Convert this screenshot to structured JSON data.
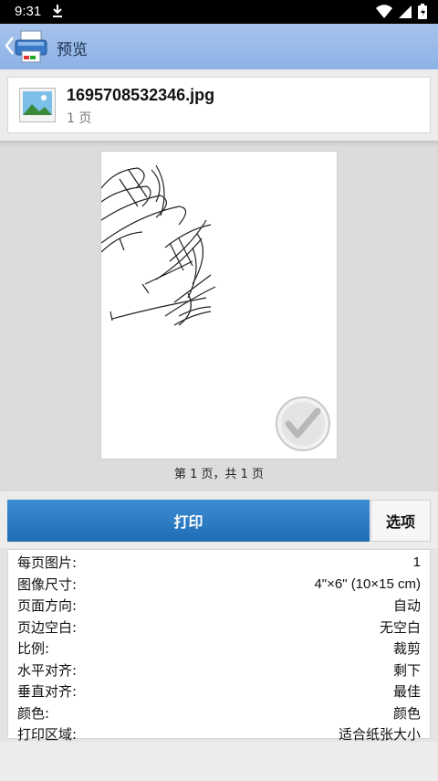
{
  "status_bar": {
    "time": "9:31"
  },
  "app_bar": {
    "title": "预览"
  },
  "file": {
    "name": "1695708532346.jpg",
    "pages": "1 页"
  },
  "preview": {
    "page_indicator": "第 1 页，共 1 页"
  },
  "actions": {
    "print_label": "打印",
    "options_label": "选项"
  },
  "settings": [
    {
      "label": "每页图片:",
      "value": "1"
    },
    {
      "label": "图像尺寸:",
      "value": "4\"×6\" (10×15 cm)"
    },
    {
      "label": "页面方向:",
      "value": "自动"
    },
    {
      "label": "页边空白:",
      "value": "无空白"
    },
    {
      "label": "比例:",
      "value": "裁剪"
    },
    {
      "label": "水平对齐:",
      "value": "剩下"
    },
    {
      "label": "垂直对齐:",
      "value": "最佳"
    },
    {
      "label": "颜色:",
      "value": "颜色"
    },
    {
      "label": "打印区域:",
      "value": "适合纸张大小"
    }
  ],
  "colors": {
    "app_bar": "#8db2e6",
    "print_button": "#1f6db5"
  }
}
